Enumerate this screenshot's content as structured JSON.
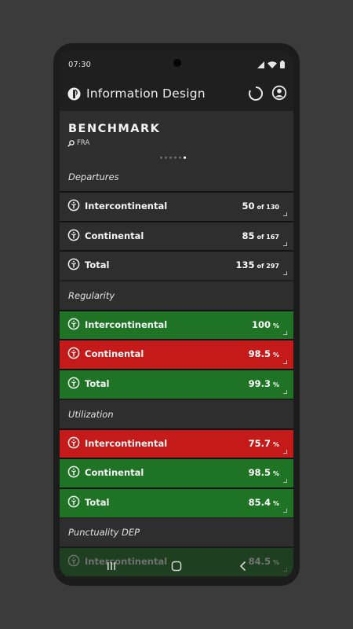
{
  "status": {
    "time": "07:30"
  },
  "app": {
    "title": "Information Design"
  },
  "benchmark": {
    "title": "BENCHMARK",
    "airport": "FRA",
    "page_dots": 6,
    "active_dot": 5
  },
  "sections": [
    {
      "title": "Departures",
      "items": [
        {
          "label": "Intercontinental",
          "value": "50",
          "unit": "of 130",
          "status": "neutral"
        },
        {
          "label": "Continental",
          "value": "85",
          "unit": "of 167",
          "status": "neutral"
        },
        {
          "label": "Total",
          "value": "135",
          "unit": "of 297",
          "status": "neutral"
        }
      ]
    },
    {
      "title": "Regularity",
      "items": [
        {
          "label": "Intercontinental",
          "value": "100",
          "unit": "%",
          "status": "good"
        },
        {
          "label": "Continental",
          "value": "98.5",
          "unit": "%",
          "status": "bad"
        },
        {
          "label": "Total",
          "value": "99.3",
          "unit": "%",
          "status": "good"
        }
      ]
    },
    {
      "title": "Utilization",
      "items": [
        {
          "label": "Intercontinental",
          "value": "75.7",
          "unit": "%",
          "status": "bad"
        },
        {
          "label": "Continental",
          "value": "98.5",
          "unit": "%",
          "status": "good"
        },
        {
          "label": "Total",
          "value": "85.4",
          "unit": "%",
          "status": "good"
        }
      ]
    },
    {
      "title": "Punctuality DEP",
      "items": [
        {
          "label": "Intercontinental",
          "value": "84.5",
          "unit": "%",
          "status": "good"
        }
      ]
    }
  ],
  "colors": {
    "good": "#1e7424",
    "bad": "#c41a1a",
    "neutral": "#2e2e2e"
  }
}
